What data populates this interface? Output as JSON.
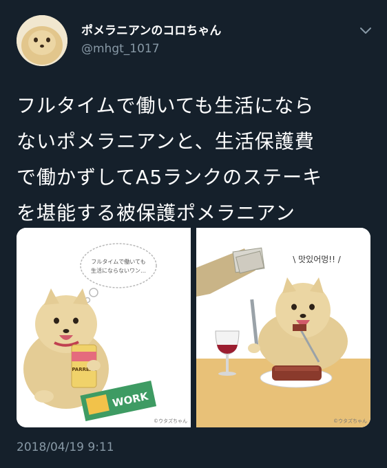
{
  "author": {
    "display_name": "ポメラニアンのコロちゃん",
    "handle": "@mhgt_1017",
    "avatar_icon": "pomeranian-avatar-icon"
  },
  "tweet": {
    "lines": [
      "フルタイムで働いても生活になら",
      "ないポメラニアンと、生活保護費",
      "で働かずしてA5ランクのステーキ",
      "を堪能する被保護ポメラニアン"
    ],
    "timestamp": "2018/04/19 9:11"
  },
  "media": {
    "left_panel": {
      "bubble_line1": "フルタイムで働いても",
      "bubble_line2": "生活にならないワン…",
      "can_label": "PARREAL",
      "magazine_label": "WORK",
      "credit": "©ウタズちゃん"
    },
    "right_panel": {
      "exclamation": "\\ 맛있어멍!! /",
      "credit": "©ウタズちゃん"
    }
  },
  "colors": {
    "background": "#15202b",
    "text_primary": "#ffffff",
    "text_secondary": "#8899a6",
    "fur": "#e9d39f",
    "table": "#e8c178",
    "envelope": "#c8b487"
  }
}
